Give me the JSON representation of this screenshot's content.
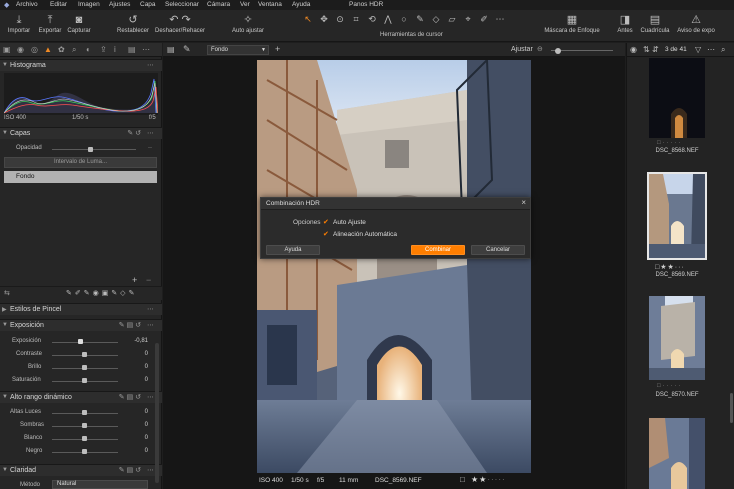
{
  "menubar": {
    "items": [
      "Archivo",
      "Editar",
      "Imagen",
      "Ajustes",
      "Capa",
      "Seleccionar",
      "Cámara",
      "Ver",
      "Ventana",
      "Ayuda"
    ],
    "title": "Panos HDR"
  },
  "toolbar": {
    "import": "Importar",
    "export": "Exportar",
    "capture": "Capturar",
    "reset": "Restablecer",
    "undo_redo": "Deshacer/Rehacer",
    "auto_adjust": "Auto ajustar",
    "cursor_tools": "Herramientas de cursor",
    "focus_mask": "Máscara de Enfoque",
    "before": "Antes",
    "grid": "Cuadrícula",
    "exposure_warning": "Aviso de expo"
  },
  "histogram": {
    "title": "Histograma",
    "iso": "ISO 400",
    "shutter": "1/50 s",
    "aperture": "f/5"
  },
  "layers": {
    "title": "Capas",
    "opacity_label": "Opacidad",
    "luma_range": "Intervalo de Luma...",
    "layer_name": "Fondo"
  },
  "brush_styles": {
    "title": "Estilos de Pincel"
  },
  "exposure": {
    "title": "Exposición",
    "rows": [
      {
        "label": "Exposición",
        "value": "-0,81"
      },
      {
        "label": "Contraste",
        "value": "0"
      },
      {
        "label": "Brillo",
        "value": "0"
      },
      {
        "label": "Saturación",
        "value": "0"
      }
    ]
  },
  "hdr": {
    "title": "Alto rango dinámico",
    "rows": [
      {
        "label": "Altas Luces",
        "value": "0"
      },
      {
        "label": "Sombras",
        "value": "0"
      },
      {
        "label": "Blanco",
        "value": "0"
      },
      {
        "label": "Negro",
        "value": "0"
      }
    ]
  },
  "clarity": {
    "title": "Claridad",
    "method_label": "Método",
    "method_value": "Natural"
  },
  "viewer": {
    "layer_select": "Fondo",
    "adjust_label": "Ajustar",
    "footer_iso": "ISO 400",
    "footer_shutter": "1/50 s",
    "footer_aperture": "f/5",
    "footer_focal": "11 mm",
    "footer_file": "DSC_8569.NEF"
  },
  "browser": {
    "counter": "3 de 41",
    "thumbs": [
      "DSC_8568.NEF",
      "DSC_8569.NEF",
      "DSC_8570.NEF"
    ]
  },
  "dialog": {
    "title": "Combinación HDR",
    "options_label": "Opciones",
    "auto_adjust": "Auto Ajuste",
    "auto_align": "Alineación Automática",
    "help": "Ayuda",
    "combine": "Combinar",
    "cancel": "Cancelar"
  },
  "colors": {
    "accent": "#ff7e00",
    "panel": "#262626"
  }
}
